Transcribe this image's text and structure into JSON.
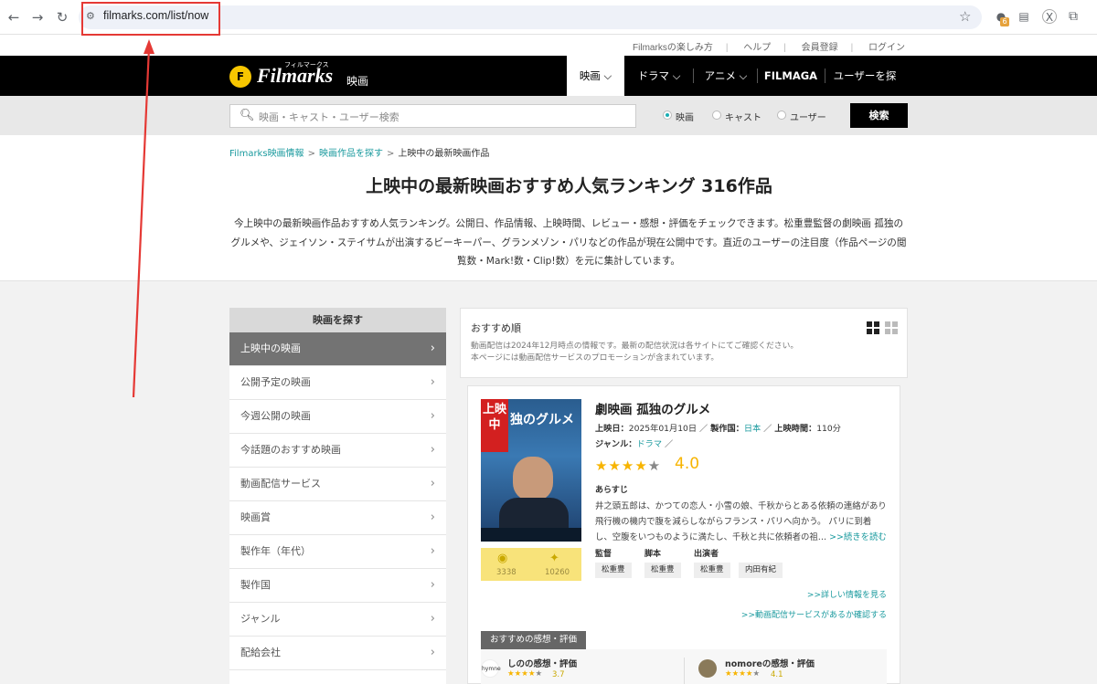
{
  "browser": {
    "url": "filmarks.com/list/now",
    "back_icon": "←",
    "forward_icon": "→",
    "reload_icon": "↻",
    "extension_badge": "6"
  },
  "util_links": [
    "Filmarksの楽しみ方",
    "ヘルプ",
    "会員登録",
    "ログイン"
  ],
  "header": {
    "logo_text": "Filmarks",
    "logo_sub": "フィルマークス",
    "logo_eiga": "映画",
    "nav": [
      "映画 ⌵",
      "ドラマ ⌵",
      "アニメ ⌵",
      "FILMAGA",
      "ユーザーを探す"
    ]
  },
  "search": {
    "placeholder": "映画・キャスト・ユーザー検索",
    "options": [
      "映画",
      "キャスト",
      "ユーザー"
    ],
    "selected": "映画",
    "button": "検索"
  },
  "breadcrumb": [
    "Filmarks映画情報",
    "映画作品を探す",
    "上映中の最新映画作品"
  ],
  "page_title": "上映中の最新映画おすすめ人気ランキング 316作品",
  "intro": "今上映中の最新映画作品おすすめ人気ランキング。公開日、作品情報、上映時間、レビュー・感想・評価をチェックできます。松重豊監督の劇映画 孤独のグルメや、ジェイソン・ステイサムが出演するビーキーパー、グランメゾン・パリなどの作品が現在公開中です。直近のユーザーの注目度（作品ページの閲覧数・Mark!数・Clip!数）を元に集計しています。",
  "sidebar": {
    "heading": "映画を探す",
    "items": [
      "上映中の映画",
      "公開予定の映画",
      "今週公開の映画",
      "今話題のおすすめ映画",
      "動画配信サービス",
      "映画賞",
      "製作年（年代）",
      "製作国",
      "ジャンル",
      "配給会社"
    ],
    "active_index": 0
  },
  "list": {
    "sort_label": "おすすめ順",
    "notice_1": "動画配信は2024年12月時点の情報です。最新の配信状況は各サイトにてご確認ください。",
    "notice_2": "本ページには動画配信サービスのプロモーションが含まれています。"
  },
  "movie": {
    "poster_ribbon": "上映中",
    "poster_title": "独のグルメ",
    "title": "劇映画 孤独のグルメ",
    "release_label": "上映日：",
    "release": "2025年01月10日",
    "country_label": "製作国：",
    "country": "日本",
    "runtime_label": "上映時間：",
    "runtime": "110分",
    "genre_label": "ジャンル：",
    "genre": "ドラマ",
    "stars": 4,
    "rating": "4.0",
    "synopsis_heading": "あらすじ",
    "synopsis": "井之頭五郎は、かつての恋人・小雪の娘、千秋からとある依頼の連絡があり 飛行機の機内で腹を減らしながらフランス・パリへ向かう。 パリに到着し、空腹をいつものように満たし、千秋と共に依頼者の祖…",
    "more_link": ">>続きを読む",
    "views": "3338",
    "marks": "10260",
    "director_label": "監督",
    "director": "松重豊",
    "writer_label": "脚本",
    "writer": "松重豊",
    "cast_label": "出演者",
    "cast": [
      "松重豊",
      "内田有紀"
    ],
    "detail_link": ">>詳しい情報を見る",
    "vod_link": ">>動画配信サービスがあるか確認する"
  },
  "reviews": {
    "tab": "おすすめの感想・評価",
    "items": [
      {
        "avatar": "hymne",
        "name": "しのの感想・評価",
        "score": "3.7",
        "stars": 4
      },
      {
        "avatar": "",
        "name": "nomoreの感想・評価",
        "score": "4.1",
        "stars": 4
      }
    ]
  },
  "colors": {
    "accent": "#1a9a9e",
    "star": "#f7b400",
    "header": "#000000"
  }
}
